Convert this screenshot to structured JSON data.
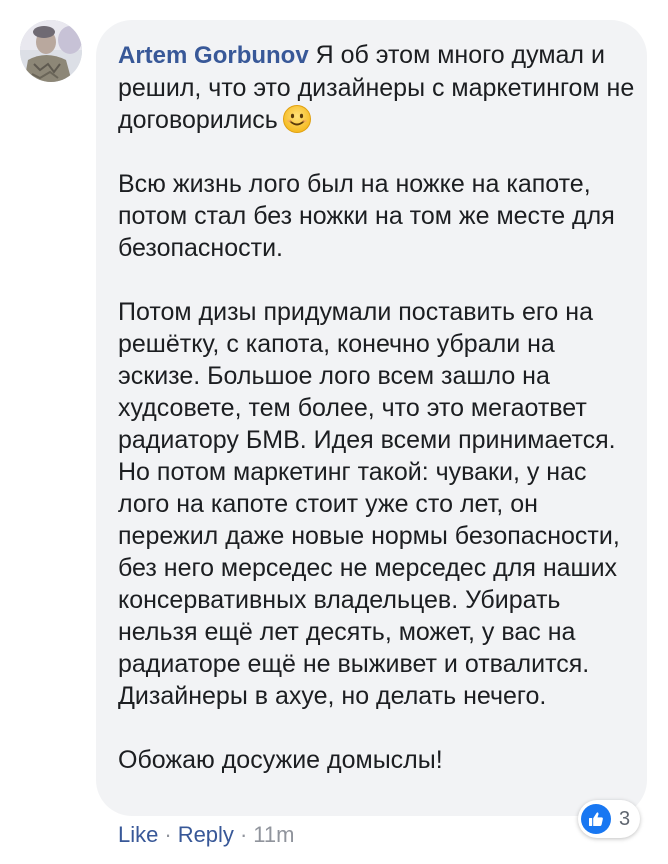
{
  "comment": {
    "author": "Artem Gorbunov",
    "paragraphs": [
      "Я об этом много думал и решил, что это дизайнеры с маркетингом не договорились",
      "Всю жизнь лого был на ножке на капоте, потом стал без ножки на том же месте для безопасности.",
      "Потом дизы придумали поставить его на решётку, с капота, конечно убрали на эскизе. Большое лого всем зашло на худсовете, тем более, что это мегаответ радиатору БМВ. Идея всеми принимается. Но потом маркетинг такой: чуваки, у нас лого на капоте стоит уже сто лет, он пережил даже новые нормы безопасности, без него мерседес не мерседес для наших консервативных владельцев. Убирать нельзя ещё лет десять, может, у вас на радиаторе ещё не выживет и отвалится. Дизайнеры в ахуе, но делать нечего.",
      "Обожаю досужие домыслы!"
    ],
    "emoji": "smiling-face-icon"
  },
  "reactions": {
    "icon": "like-icon",
    "count": "3"
  },
  "actions": {
    "like": "Like",
    "reply": "Reply",
    "separator": "·",
    "time": "11m"
  },
  "colors": {
    "link": "#385898",
    "bubble": "#f2f3f5",
    "like_badge": "#1877f2",
    "muted": "#90949c"
  }
}
